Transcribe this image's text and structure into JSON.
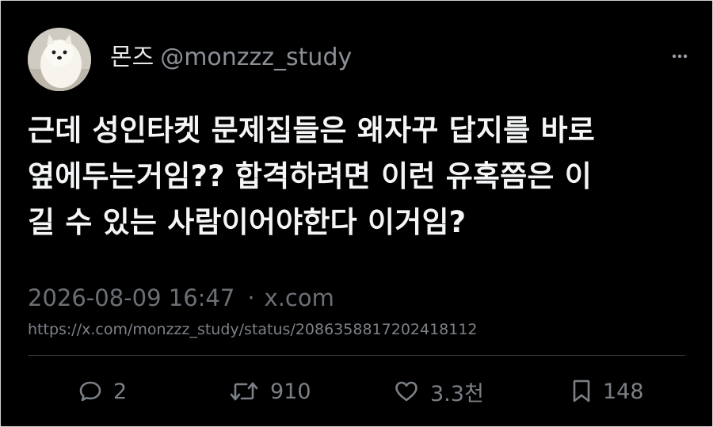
{
  "user": {
    "display_name": "몬즈",
    "handle": "@monzzz_study",
    "avatar_icon": "puppy-avatar"
  },
  "tweet": {
    "lines": [
      "근데 성인타켓 문제집들은 왜자꾸 답지를 바로",
      "옆에두는거임?? 합격하려면 이런 유혹쯤은 이",
      "길 수 있는 사람이어야한다 이거임?"
    ]
  },
  "meta": {
    "timestamp": "2026-08-09 16:47",
    "separator": "·",
    "source": "x.com",
    "url": "https://x.com/monzzz_study/status/2086358817202418112"
  },
  "actions": {
    "replies": "2",
    "retweets": "910",
    "likes": "3.3천",
    "bookmarks": "148"
  },
  "icons": {
    "more": "more-dots-icon",
    "reply": "reply-bubble-icon",
    "retweet": "retweet-icon",
    "like": "heart-icon",
    "bookmark": "bookmark-icon"
  },
  "colors": {
    "background": "#000000",
    "text": "#f4f5f6",
    "muted": "#6b7075"
  }
}
